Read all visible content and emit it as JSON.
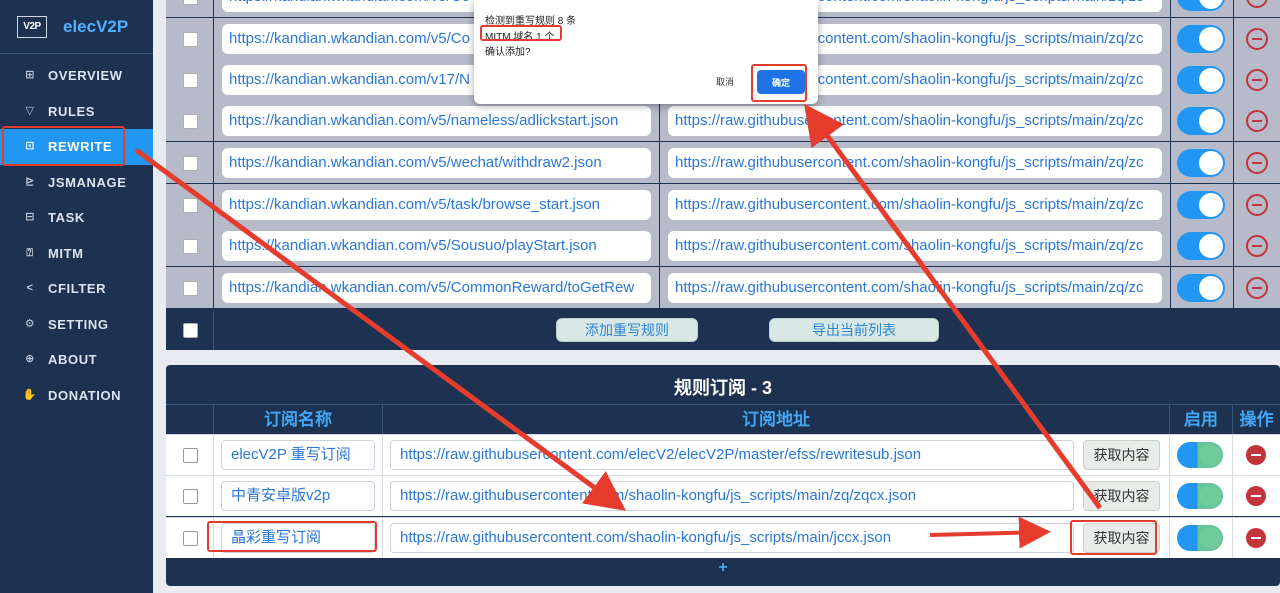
{
  "app": {
    "logo_text": "V2P",
    "name": "elecV2P"
  },
  "nav": [
    {
      "label": "OVERVIEW",
      "icon": "grid-icon",
      "glyph": "⊞"
    },
    {
      "label": "RULES",
      "icon": "filter-icon",
      "glyph": "▽"
    },
    {
      "label": "REWRITE",
      "icon": "rewrite-icon",
      "glyph": "⊡"
    },
    {
      "label": "JSMANAGE",
      "icon": "terminal-icon",
      "glyph": "⊵"
    },
    {
      "label": "TASK",
      "icon": "task-icon",
      "glyph": "⊟"
    },
    {
      "label": "MITM",
      "icon": "certificate-icon",
      "glyph": "⍰"
    },
    {
      "label": "CFILTER",
      "icon": "share-icon",
      "glyph": "<"
    },
    {
      "label": "SETTING",
      "icon": "gear-icon",
      "glyph": "⚙"
    },
    {
      "label": "ABOUT",
      "icon": "globe-icon",
      "glyph": "⊕"
    },
    {
      "label": "DONATION",
      "icon": "hand-icon",
      "glyph": "✋"
    }
  ],
  "rewrite_rows": [
    {
      "match": "https://kandian.wkandian.com/v5/Co",
      "target": "https://raw.githubusercontent.com/shaolin-kongfu/js_scripts/main/zq/zc"
    },
    {
      "match": "https://kandian.wkandian.com/v17/N",
      "target": "https://raw.githubusercontent.com/shaolin-kongfu/js_scripts/main/zq/zc"
    },
    {
      "match": "https://kandian.wkandian.com/v5/nameless/adlickstart.json",
      "target": "https://raw.githubusercontent.com/shaolin-kongfu/js_scripts/main/zq/zc"
    },
    {
      "match": "https://kandian.wkandian.com/v5/wechat/withdraw2.json",
      "target": "https://raw.githubusercontent.com/shaolin-kongfu/js_scripts/main/zq/zc"
    },
    {
      "match": "https://kandian.wkandian.com/v5/task/browse_start.json",
      "target": "https://raw.githubusercontent.com/shaolin-kongfu/js_scripts/main/zq/zc"
    },
    {
      "match": "https://kandian.wkandian.com/v5/Sousuo/playStart.json",
      "target": "https://raw.githubusercontent.com/shaolin-kongfu/js_scripts/main/zq/zc"
    },
    {
      "match": "https://kandian.wkandian.com/v5/CommonReward/toGetRew",
      "target": "https://raw.githubusercontent.com/shaolin-kongfu/js_scripts/main/zq/zc"
    }
  ],
  "rewrite_footer": {
    "add_label": "添加重写规则",
    "export_label": "导出当前列表"
  },
  "subscription": {
    "title": "规则订阅 - 3",
    "columns": {
      "name": "订阅名称",
      "url": "订阅地址",
      "enable": "启用",
      "action": "操作"
    },
    "fetch_label": "获取内容",
    "rows": [
      {
        "name": "elecV2P 重写订阅",
        "url": "https://raw.githubusercontent.com/elecV2/elecV2P/master/efss/rewritesub.json"
      },
      {
        "name": "中青安卓版v2p",
        "url": "https://raw.githubusercontent.com/shaolin-kongfu/js_scripts/main/zq/zqcx.json"
      },
      {
        "name": "晶彩重写订阅",
        "url": "https://raw.githubusercontent.com/shaolin-kongfu/js_scripts/main/jccx.json"
      }
    ],
    "add_symbol": "+"
  },
  "dialog": {
    "line1": "检测到重写规则 8 条",
    "line2": "MITM 域名 1 个",
    "line3": "确认添加?",
    "cancel_label": "取消",
    "ok_label": "确定"
  },
  "colors": {
    "sidebar": "#1d3250",
    "active": "#2196f3",
    "annotation": "#e53c2e"
  }
}
